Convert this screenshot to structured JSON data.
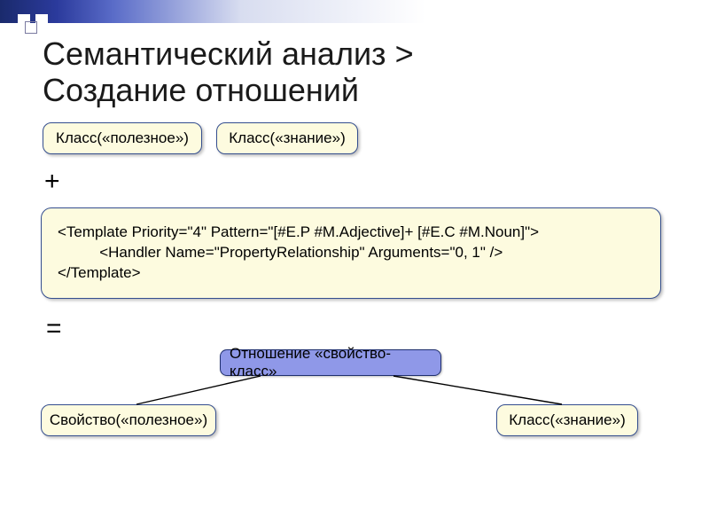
{
  "title_line1": "Семантический анализ >",
  "title_line2": "Создание отношений",
  "class_useful": "Класс(«полезное»)",
  "class_knowledge": "Класс(«знание»)",
  "op_plus": "+",
  "code_line1": "<Template Priority=\"4\" Pattern=\"[#E.P #M.Adjective]+ [#E.C #M.Noun]\">",
  "code_line2": "          <Handler Name=\"PropertyRelationship\" Arguments=\"0, 1\" />",
  "code_line3": "</Template>",
  "op_equals": "=",
  "relation_label": "Отношение «свойство-класс»",
  "property_useful": "Свойство(«полезное»)",
  "class_knowledge2": "Класс(«знание»)"
}
